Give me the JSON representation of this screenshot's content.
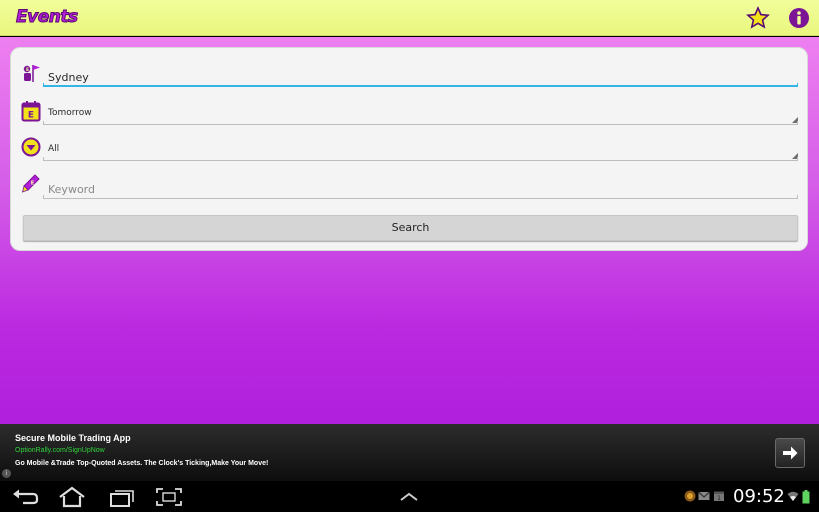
{
  "app": {
    "logo_text": "Events"
  },
  "action_bar": {
    "favorites_icon": "star-icon",
    "info_icon": "info-icon"
  },
  "form": {
    "location": {
      "icon": "location-flag-icon",
      "value": "Sydney"
    },
    "date": {
      "icon": "calendar-icon",
      "selected": "Tomorrow"
    },
    "category": {
      "icon": "dropdown-circle-icon",
      "selected": "All"
    },
    "keyword": {
      "icon": "pencil-icon",
      "value": "",
      "placeholder": "Keyword"
    },
    "search_label": "Search"
  },
  "ad": {
    "title": "Secure Mobile Trading App",
    "url": "OptionRally.com/SignUpNow",
    "description": "Go Mobile &Trade Top-Quoted Assets. The Clock's Ticking,Make Your Move!",
    "info_label": "i"
  },
  "system": {
    "time": "09:52",
    "nav": [
      "back-icon",
      "home-icon",
      "recent-apps-icon",
      "screenshot-icon",
      "menu-up-icon"
    ],
    "tray": [
      "app-notification-icon",
      "gmail-icon",
      "calendar-notification-icon",
      "wifi-icon",
      "battery-icon"
    ]
  },
  "colors": {
    "accent": "#33b5e5",
    "brand": "#b51ed9",
    "action_bar": "#eaf880"
  }
}
